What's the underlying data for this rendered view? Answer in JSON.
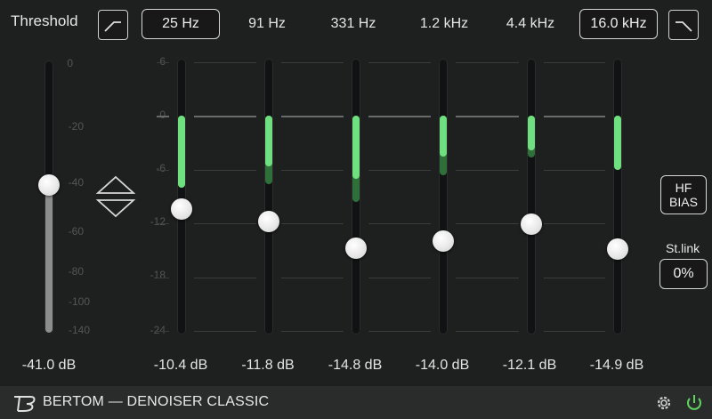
{
  "header": {
    "threshold_label": "Threshold",
    "low_freq_value": "25 Hz",
    "band_freqs": [
      "91 Hz",
      "331 Hz",
      "1.2 kHz",
      "4.4 kHz"
    ],
    "high_freq_value": "16.0 kHz",
    "low_filter_icon": "high-pass-curve-icon",
    "high_filter_icon": "low-pass-curve-icon"
  },
  "threshold": {
    "scale": [
      "0",
      "-20",
      "-40",
      "-60",
      "-80",
      "-100",
      "-140"
    ],
    "value_label": "-41.0 dB",
    "value_db": -41.0
  },
  "link_icon": "linked-arrows-icon",
  "bands": {
    "scale": [
      "6",
      "0",
      "-6",
      "-12",
      "-18",
      "-24"
    ],
    "range_db": [
      -24,
      6
    ],
    "items": [
      {
        "value_label": "-10.4 dB",
        "value_db": -10.4,
        "reduction_bright_db": -8.0,
        "reduction_dim_db": -8.0
      },
      {
        "value_label": "-11.8 dB",
        "value_db": -11.8,
        "reduction_bright_db": -5.6,
        "reduction_dim_db": -7.6
      },
      {
        "value_label": "-14.8 dB",
        "value_db": -14.8,
        "reduction_bright_db": -7.0,
        "reduction_dim_db": -9.6
      },
      {
        "value_label": "-14.0 dB",
        "value_db": -14.0,
        "reduction_bright_db": -4.5,
        "reduction_dim_db": -6.6
      },
      {
        "value_label": "-12.1 dB",
        "value_db": -12.1,
        "reduction_bright_db": -3.8,
        "reduction_dim_db": -4.6
      },
      {
        "value_label": "-14.9 dB",
        "value_db": -14.9,
        "reduction_bright_db": -6.0,
        "reduction_dim_db": -6.0
      }
    ]
  },
  "side": {
    "hf_bias_label_1": "HF",
    "hf_bias_label_2": "BIAS",
    "stlink_label": "St.link",
    "stlink_value": "0%"
  },
  "footer": {
    "brand": "BERTOM — DENOISER CLASSIC",
    "settings_icon": "gear-icon",
    "power_icon": "power-icon"
  },
  "colors": {
    "green_bright": "#6fe07f",
    "green_dim": "#2f6f3a",
    "power": "#5fd35f"
  }
}
